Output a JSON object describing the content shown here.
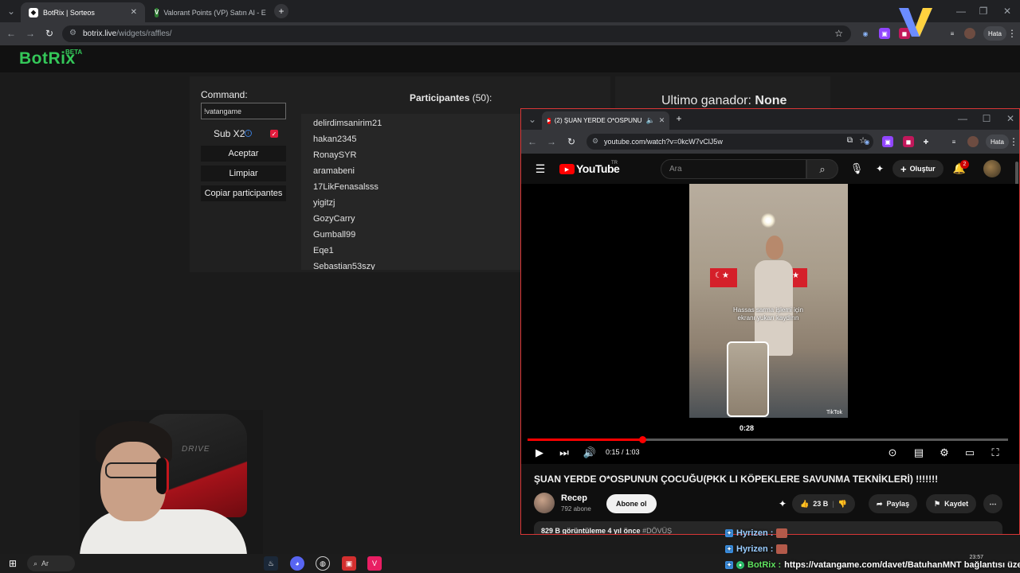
{
  "browser": {
    "tabs": [
      {
        "label": "BotRix | Sorteos",
        "active": true
      },
      {
        "label": "Valorant Points (VP) Satın Al - E",
        "active": false
      }
    ],
    "url_host": "botrix.live",
    "url_path": "/widgets/raffles/",
    "profile_label": "Hata"
  },
  "botrix": {
    "logo": "BotRix",
    "logo_badge": "BETA",
    "command_label": "Command:",
    "command_value": "!vatangame",
    "sub_label": "Sub X2",
    "sub_checked": true,
    "buttons": {
      "accept": "Aceptar",
      "clear": "Limpiar",
      "copy": "Copiar participantes"
    },
    "participants_label": "Participantes",
    "participants_count": "(50):",
    "participants": [
      "delirdimsanirim21",
      "hakan2345",
      "RonaySYR",
      "aramabeni",
      "17LikFenasalsss",
      "yigitzj",
      "GozyCarry",
      "Gumball99",
      "Eqe1",
      "Sebastian53szy"
    ],
    "winner_label": "Ultimo ganador:",
    "winner_value": "None"
  },
  "youtube_window": {
    "tab_label": "(2) ŞUAN YERDE O*OSPUNU",
    "url": "youtube.com/watch?v=0kcW7vClJ5w",
    "profile_label": "Hata",
    "logo_text": "YouTube",
    "logo_region": "TR",
    "search_placeholder": "Ara",
    "create_label": "Oluştur",
    "notification_count": "2",
    "video": {
      "hint": "Hassas sarma işlemi için ekranı yukarı kaydırın",
      "preview_time": "0:28",
      "watermark": "TikTok",
      "progress_fraction": 0.238,
      "time_current": "0:15",
      "time_total": "1:03",
      "time_readout": "0:15 / 1:03"
    },
    "title": "ŞUAN YERDE O*OSPUNUN ÇOCUĞU(PKK LI KÖPEKLERE SAVUNMA TEKNİKLERİ) !!!!!!!",
    "channel_name": "Recep",
    "channel_subs": "792 abone",
    "subscribe_label": "Abone ol",
    "likes": "23 B",
    "share_label": "Paylaş",
    "save_label": "Kaydet",
    "description_stats": "829 B görüntüleme  4 yıl önce",
    "description_tag": "#DÖVÜŞ"
  },
  "chat": [
    {
      "name": "Hyrizen :",
      "message": ""
    },
    {
      "name": "Hyrizen :",
      "message": ""
    },
    {
      "name": "BotRix :",
      "message": "https://vatangame.com/davet/BatuhanMNT bağlantısı üzerin"
    }
  ],
  "webcam": {
    "chair_brand": "DRIVE"
  },
  "taskbar": {
    "search_text": "Ar",
    "clock": "23:57"
  }
}
